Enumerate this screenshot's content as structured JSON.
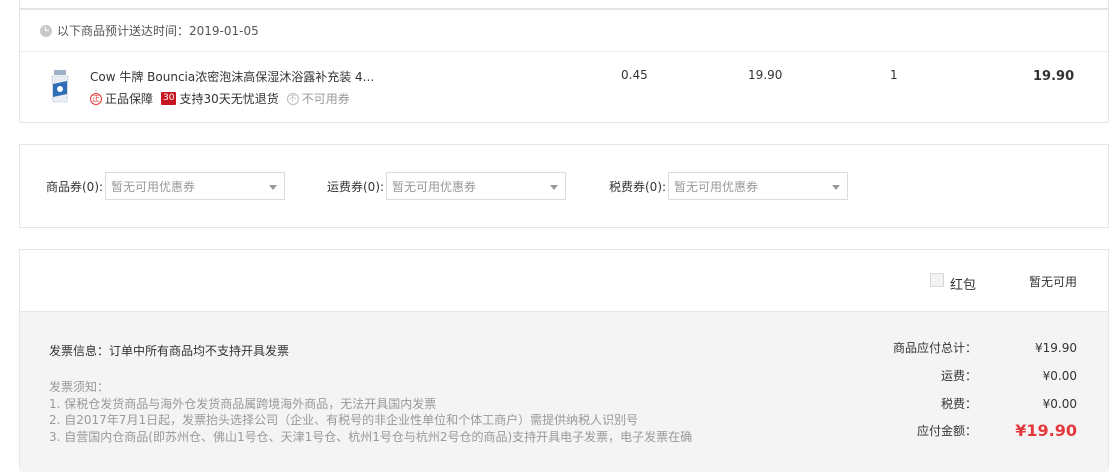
{
  "delivery": {
    "text": "以下商品预计送达时间：2019-01-05"
  },
  "product": {
    "title": "Cow 牛牌 Bouncia浓密泡沫高保湿沐浴露补充装 4...",
    "tags": {
      "genuine_icon": "正",
      "genuine": "正品保障",
      "return_badge": "30",
      "return": "支持30天无忧退货",
      "coupon_icon": "不",
      "coupon": "不可用券"
    },
    "weight": "0.45",
    "unit_price": "19.90",
    "quantity": "1",
    "subtotal": "19.90"
  },
  "coupons": {
    "goods": {
      "label": "商品券(0):",
      "placeholder": "暂无可用优惠券"
    },
    "shipping": {
      "label": "运费券(0):",
      "placeholder": "暂无可用优惠券"
    },
    "tax": {
      "label": "税费券(0):",
      "placeholder": "暂无可用优惠券"
    }
  },
  "redpacket": {
    "label": "红包",
    "status": "暂无可用"
  },
  "invoice": {
    "info": "发票信息：订单中所有商品均不支持开具发票",
    "notice_title": "发票须知：",
    "notice_lines": [
      "1. 保税仓发货商品与海外仓发货商品属跨境海外商品，无法开具国内发票",
      "2. 自2017年7月1日起，发票抬头选择公司（企业、有税号的非企业性单位和个体工商户）需提供纳税人识别号",
      "3. 自营国内仓商品(即苏州仓、佛山1号仓、天津1号仓、杭州1号仓与杭州2号仓的商品)支持开具电子发票，电子发票在确"
    ]
  },
  "summary": {
    "goods_total_label": "商品应付总计：",
    "goods_total": "¥19.90",
    "shipping_label": "运费：",
    "shipping": "¥0.00",
    "tax_label": "税费：",
    "tax": "¥0.00",
    "payable_label": "应付金额：",
    "payable": "¥19.90"
  },
  "colors": {
    "accent_red": "#e4393c",
    "badge_red": "#c81623",
    "border": "#e6e6e6",
    "panel_bg": "#f4f4f4"
  }
}
